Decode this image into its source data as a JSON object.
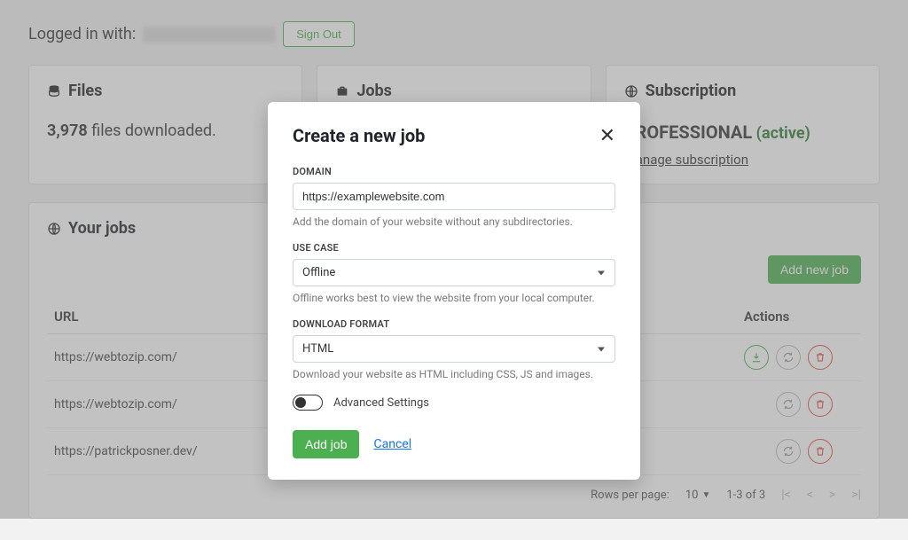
{
  "topbar": {
    "login_label": "Logged in with:",
    "signout_label": "Sign Out"
  },
  "cards": {
    "files": {
      "title": "Files",
      "count": "3,978",
      "suffix": "files downloaded."
    },
    "jobs": {
      "title": "Jobs"
    },
    "subscription": {
      "title": "Subscription",
      "plan": "PROFESSIONAL",
      "status": "(active)",
      "manage_label": "Manage subscription"
    }
  },
  "jobs_panel": {
    "title": "Your jobs",
    "add_button": "Add new job",
    "columns": {
      "url": "URL",
      "actions": "Actions"
    },
    "rows": [
      {
        "url": "https://webtozip.com/"
      },
      {
        "url": "https://webtozip.com/"
      },
      {
        "url": "https://patrickposner.dev/"
      }
    ],
    "pagination": {
      "rows_label": "Rows per page:",
      "rows_value": "10",
      "range": "1-3 of 3"
    }
  },
  "modal": {
    "title": "Create a new job",
    "domain": {
      "label": "DOMAIN",
      "value": "https://examplewebsite.com",
      "help": "Add the domain of your website without any subdirectories."
    },
    "usecase": {
      "label": "USE CASE",
      "value": "Offline",
      "help": "Offline works best to view the website from your local computer."
    },
    "format": {
      "label": "DOWNLOAD FORMAT",
      "value": "HTML",
      "help": "Download your website as HTML including CSS, JS and images."
    },
    "advanced_label": "Advanced Settings",
    "submit_label": "Add job",
    "cancel_label": "Cancel"
  }
}
